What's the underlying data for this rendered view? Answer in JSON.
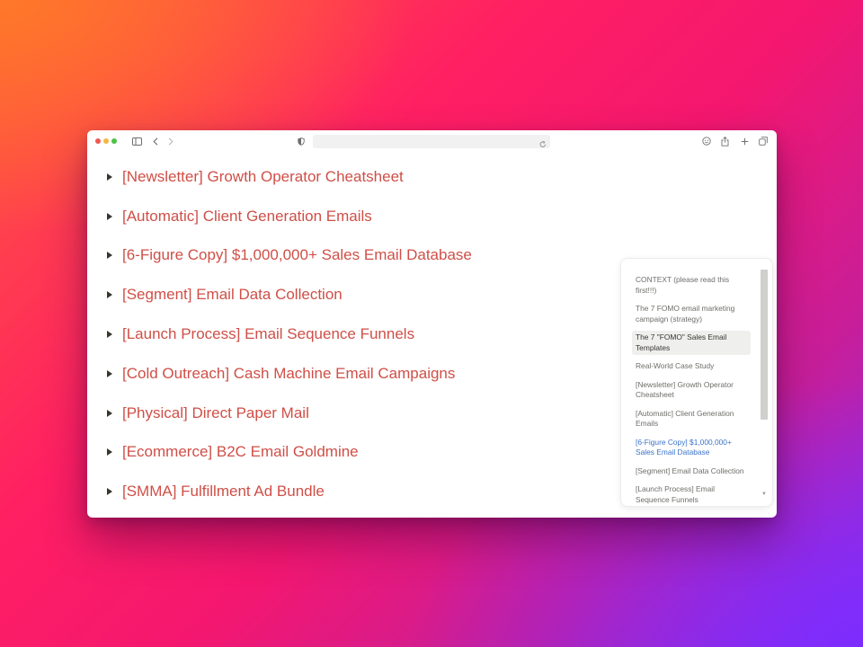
{
  "browser": {
    "address": "",
    "icons": [
      "sidebar-icon",
      "back-icon",
      "forward-icon",
      "shield-icon",
      "reload-icon",
      "account-icon",
      "share-icon",
      "new-tab-icon",
      "tabs-overview-icon"
    ]
  },
  "page": {
    "toggles": [
      {
        "title": "[Newsletter] Growth Operator Cheatsheet"
      },
      {
        "title": "[Automatic] Client Generation Emails"
      },
      {
        "title": "[6-Figure Copy] $1,000,000+ Sales Email Database"
      },
      {
        "title": "[Segment] Email Data Collection"
      },
      {
        "title": "[Launch Process] Email Sequence Funnels"
      },
      {
        "title": "[Cold Outreach] Cash Machine Email Campaigns"
      },
      {
        "title": "[Physical] Direct Paper Mail"
      },
      {
        "title": "[Ecommerce] B2C Email Goldmine"
      },
      {
        "title": "[SMMA] Fulfillment Ad Bundle"
      }
    ],
    "title_color": "#cf4f47"
  },
  "toc": {
    "items": [
      {
        "label": "CONTEXT (please read this first!!!)",
        "state": "normal"
      },
      {
        "label": "The 7 FOMO email marketing campaign (strategy)",
        "state": "normal"
      },
      {
        "label": "The 7 \"FOMO\" Sales Email Templates",
        "state": "active"
      },
      {
        "label": "Real-World Case Study",
        "state": "normal"
      },
      {
        "label": "[Newsletter] Growth Operator Cheatsheet",
        "state": "normal"
      },
      {
        "label": "[Automatic] Client Generation Emails",
        "state": "normal"
      },
      {
        "label": "[6-Figure Copy] $1,000,000+ Sales Email Database",
        "state": "link"
      },
      {
        "label": "[Segment] Email Data Collection",
        "state": "normal"
      },
      {
        "label": "[Launch Process] Email Sequence Funnels",
        "state": "normal"
      }
    ],
    "scroll_fraction": 0.0
  },
  "colors": {
    "accent_link": "#3b73c9",
    "active_bg": "#efefed",
    "traffic_red": "#ee5a52",
    "traffic_yellow": "#f4b740",
    "traffic_green": "#4fc04a"
  }
}
